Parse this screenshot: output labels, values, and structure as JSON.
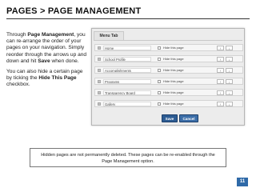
{
  "slide": {
    "title": "PAGES > PAGE MANAGEMENT",
    "page_number": "11"
  },
  "instructions": {
    "p1_before": "Through ",
    "p1_link1": "Page Management",
    "p1_middle": ", you can re-arrange the order of your pages on your navigation. Simply reorder through the arrows up and down and hit ",
    "p1_link2": "Save",
    "p1_after": " when done.",
    "p2_before": "You can also hide a certain page by ticking the ",
    "p2_link": "Hide This Page",
    "p2_after": " checkbox."
  },
  "screenshot": {
    "tab_label": "Menu Tab",
    "rows": [
      {
        "name": "Home",
        "hide_label": "Hide this page"
      },
      {
        "name": "School Profile",
        "hide_label": "Hide this page"
      },
      {
        "name": "Accomplishments",
        "hide_label": "Hide this page"
      },
      {
        "name": "Programs",
        "hide_label": "Hide this page"
      },
      {
        "name": "Transparency Board",
        "hide_label": "Hide this page"
      },
      {
        "name": "Gallery",
        "hide_label": "Hide this page"
      }
    ],
    "up_arrow": "↑",
    "down_arrow": "↓",
    "save_label": "Save",
    "cancel_label": "Cancel"
  },
  "note": {
    "text": "Hidden pages are not permanently deleted. These pages can be re-enabled through the Page Management option."
  },
  "colors": {
    "accent": "#2f6aa8",
    "button": "#2d5c93"
  }
}
